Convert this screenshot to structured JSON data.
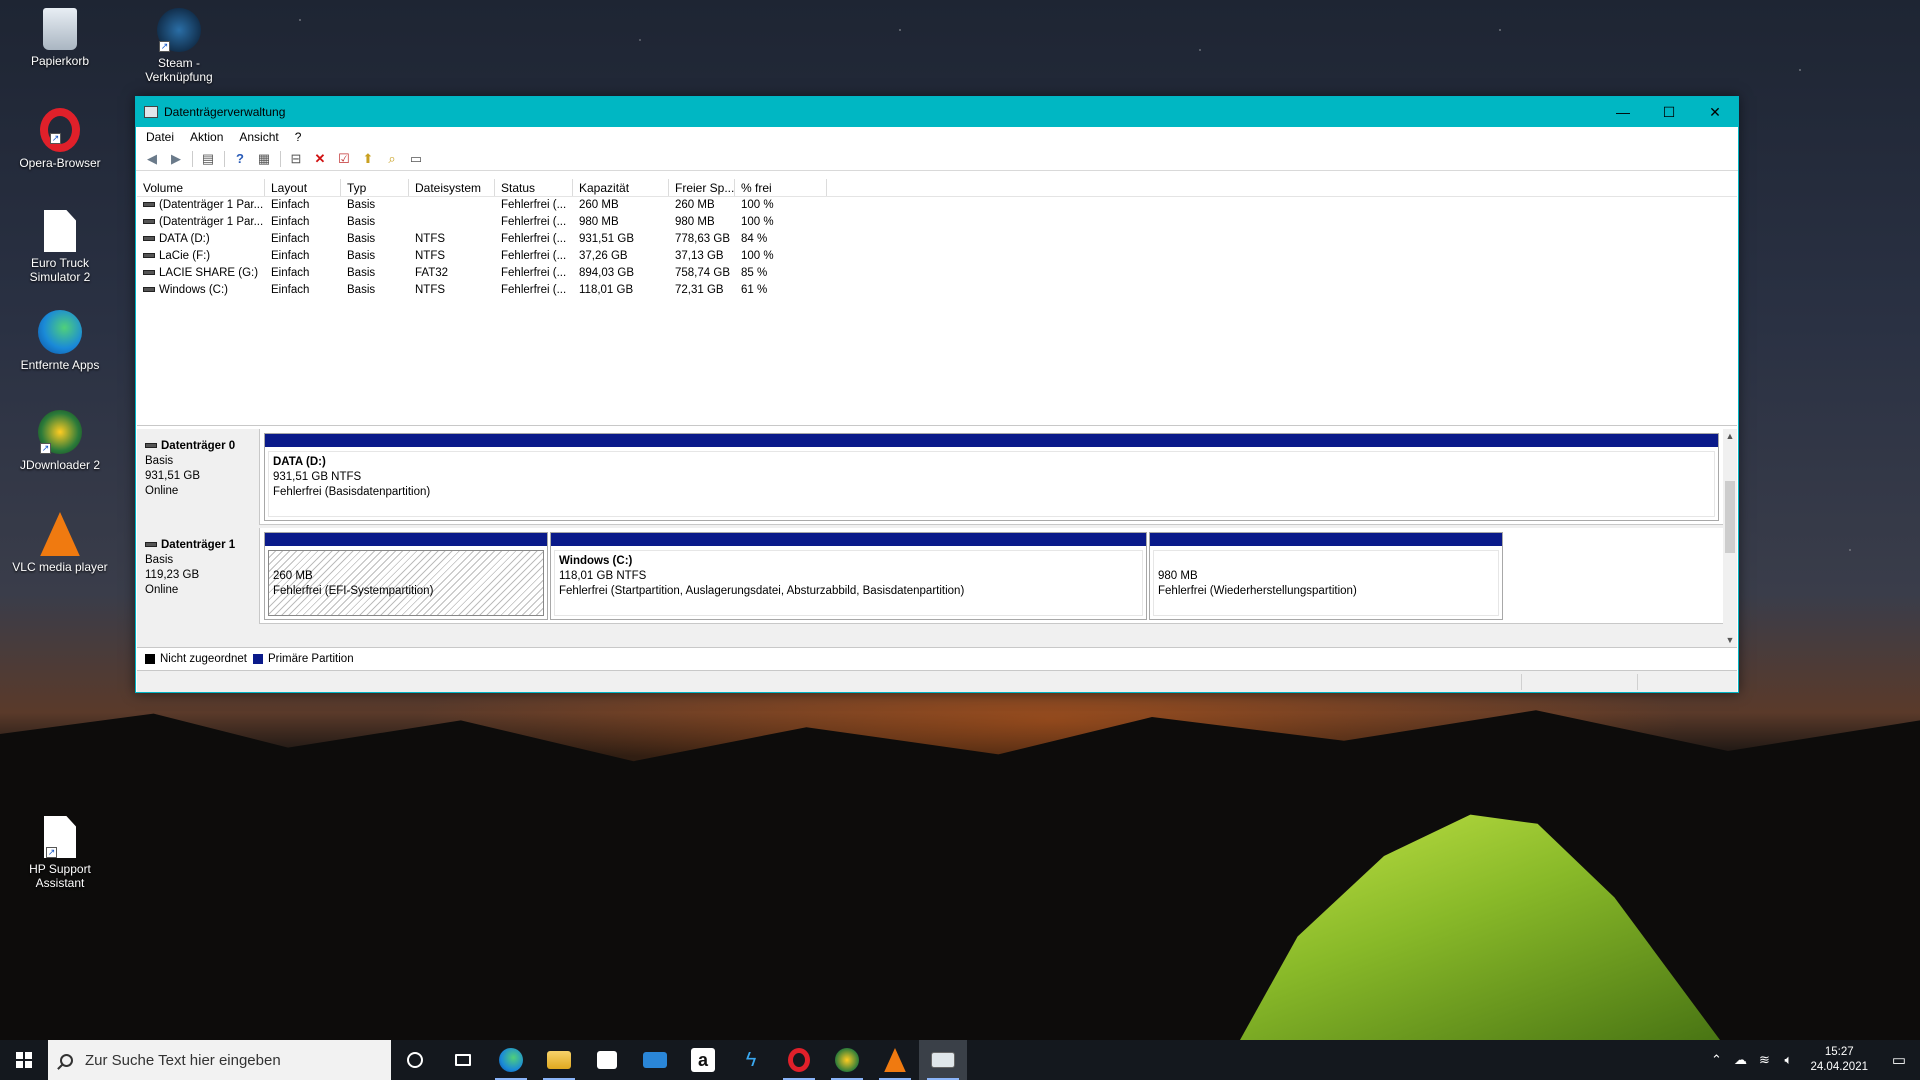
{
  "desktop": {
    "icons": [
      {
        "label": "Papierkorb"
      },
      {
        "label": "Steam - Verknüpfung"
      },
      {
        "label": "Opera-Browser"
      },
      {
        "label": "Euro Truck Simulator 2"
      },
      {
        "label": "Entfernte Apps"
      },
      {
        "label": "JDownloader 2"
      },
      {
        "label": "VLC media player"
      },
      {
        "label": "HP Support Assistant"
      }
    ]
  },
  "window": {
    "title": "Datenträgerverwaltung",
    "controls": {
      "minimize": "—",
      "maximize": "☐",
      "close": "✕"
    },
    "menu": [
      "Datei",
      "Aktion",
      "Ansicht",
      "?"
    ],
    "toolbar_icons": [
      "back-icon",
      "forward-icon",
      "console-tree-icon",
      "help-icon",
      "properties-icon",
      "connect-icon",
      "delete-icon",
      "checkmark-icon",
      "import-icon",
      "search-icon",
      "details-icon"
    ]
  },
  "volume_list": {
    "columns": [
      "Volume",
      "Layout",
      "Typ",
      "Dateisystem",
      "Status",
      "Kapazität",
      "Freier Sp...",
      "% frei"
    ],
    "rows": [
      {
        "volume": "(Datenträger 1 Par...",
        "layout": "Einfach",
        "typ": "Basis",
        "fs": "",
        "status": "Fehlerfrei (...",
        "capacity": "260 MB",
        "free": "260 MB",
        "pct": "100 %"
      },
      {
        "volume": "(Datenträger 1 Par...",
        "layout": "Einfach",
        "typ": "Basis",
        "fs": "",
        "status": "Fehlerfrei (...",
        "capacity": "980 MB",
        "free": "980 MB",
        "pct": "100 %"
      },
      {
        "volume": "DATA (D:)",
        "layout": "Einfach",
        "typ": "Basis",
        "fs": "NTFS",
        "status": "Fehlerfrei (...",
        "capacity": "931,51 GB",
        "free": "778,63 GB",
        "pct": "84 %"
      },
      {
        "volume": "LaCie (F:)",
        "layout": "Einfach",
        "typ": "Basis",
        "fs": "NTFS",
        "status": "Fehlerfrei (...",
        "capacity": "37,26 GB",
        "free": "37,13 GB",
        "pct": "100 %"
      },
      {
        "volume": "LACIE SHARE (G:)",
        "layout": "Einfach",
        "typ": "Basis",
        "fs": "FAT32",
        "status": "Fehlerfrei (...",
        "capacity": "894,03 GB",
        "free": "758,74 GB",
        "pct": "85 %"
      },
      {
        "volume": "Windows (C:)",
        "layout": "Einfach",
        "typ": "Basis",
        "fs": "NTFS",
        "status": "Fehlerfrei (...",
        "capacity": "118,01 GB",
        "free": "72,31 GB",
        "pct": "61 %"
      }
    ]
  },
  "disks": [
    {
      "name": "Datenträger 0",
      "type": "Basis",
      "size": "931,51 GB",
      "state": "Online",
      "partitions": [
        {
          "name": "DATA  (D:)",
          "size": "931,51 GB NTFS",
          "status": "Fehlerfrei (Basisdatenpartition)"
        }
      ]
    },
    {
      "name": "Datenträger 1",
      "type": "Basis",
      "size": "119,23 GB",
      "state": "Online",
      "partitions": [
        {
          "name": "",
          "size": "260 MB",
          "status": "Fehlerfrei (EFI-Systempartition)"
        },
        {
          "name": "Windows  (C:)",
          "size": "118,01 GB NTFS",
          "status": "Fehlerfrei (Startpartition, Auslagerungsdatei, Absturzabbild, Basisdatenpartition)"
        },
        {
          "name": "",
          "size": "980 MB",
          "status": "Fehlerfrei (Wiederherstellungspartition)"
        }
      ]
    }
  ],
  "legend": [
    {
      "label": "Nicht zugeordnet",
      "color": "#000000"
    },
    {
      "label": "Primäre Partition",
      "color": "#0a1a8a"
    }
  ],
  "taskbar": {
    "search_placeholder": "Zur Suche Text hier eingeben",
    "apps": [
      "cortana-icon",
      "task-view-icon",
      "edge-icon",
      "explorer-icon",
      "store-icon",
      "mail-icon",
      "amazon-icon",
      "bolt-icon",
      "opera-icon",
      "jdownloader-icon",
      "vlc-icon",
      "disk-management-icon"
    ],
    "time": "15:27",
    "date": "24.04.2021"
  },
  "colors": {
    "titlebar": "#00b7c3",
    "primary_partition": "#0a1a8a",
    "taskbar": "#14181e"
  }
}
